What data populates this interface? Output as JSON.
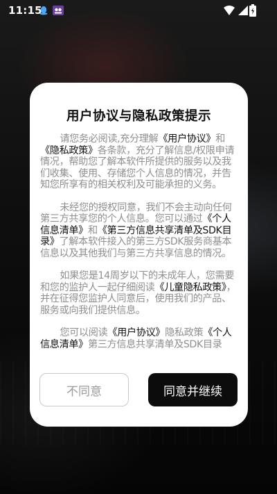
{
  "status_bar": {
    "time": "11:15",
    "icons": [
      "qq-icon",
      "app-notification-icon",
      "wifi-icon",
      "signal-icon",
      "battery-icon"
    ]
  },
  "dialog": {
    "title": "用户协议与隐私政策提示",
    "paragraphs": [
      [
        {
          "text": "请您务必阅读,充分理解",
          "link": false
        },
        {
          "text": "《用户协议》",
          "link": true
        },
        {
          "text": "和",
          "link": false
        },
        {
          "text": "《隐私政策》",
          "link": true
        },
        {
          "text": "各条款，充分了解信息/权限申请情况，帮助您了解本软件所提供的服务以及我们收集、使用、存储您个人信息的情况，并告知您所享有的相关权利及可能承担的义务。",
          "link": false
        }
      ],
      [
        {
          "text": "未经您的授权同意，我们不会主动向任何第三方共享您的个人信息。您可以通过",
          "link": false
        },
        {
          "text": "《个人信息清单》",
          "link": true
        },
        {
          "text": "和",
          "link": false
        },
        {
          "text": "《第三方信息共享清单及SDK目录》",
          "link": true
        },
        {
          "text": "了解本软件接入的第三方SDK服务商基本信息以及其他我们与第三方共享信息的情况。",
          "link": false
        }
      ],
      [
        {
          "text": "如果您是14周岁以下的未成年人，您需要和您的监护人一起仔细阅读",
          "link": false
        },
        {
          "text": "《儿童隐私政策》",
          "link": true
        },
        {
          "text": "，并在征得您监护人同意后，使用我们的产品、服务或向我们提供信息。",
          "link": false
        }
      ],
      [
        {
          "text": "您可以阅读",
          "link": false
        },
        {
          "text": "《用户协议》",
          "link": true
        },
        {
          "text": "隐私政策",
          "link": false
        },
        {
          "text": "《个人信息清单》",
          "link": true
        },
        {
          "text": "第三方信息共享清单及SDK目录",
          "link": false
        }
      ]
    ],
    "buttons": {
      "disagree": "不同意",
      "agree": "同意并继续"
    }
  },
  "colors": {
    "dialog_bg": "#ffffff",
    "body_text": "#8f8f8f",
    "link_text": "#111111",
    "agree_button_bg": "#0c0c0c"
  }
}
